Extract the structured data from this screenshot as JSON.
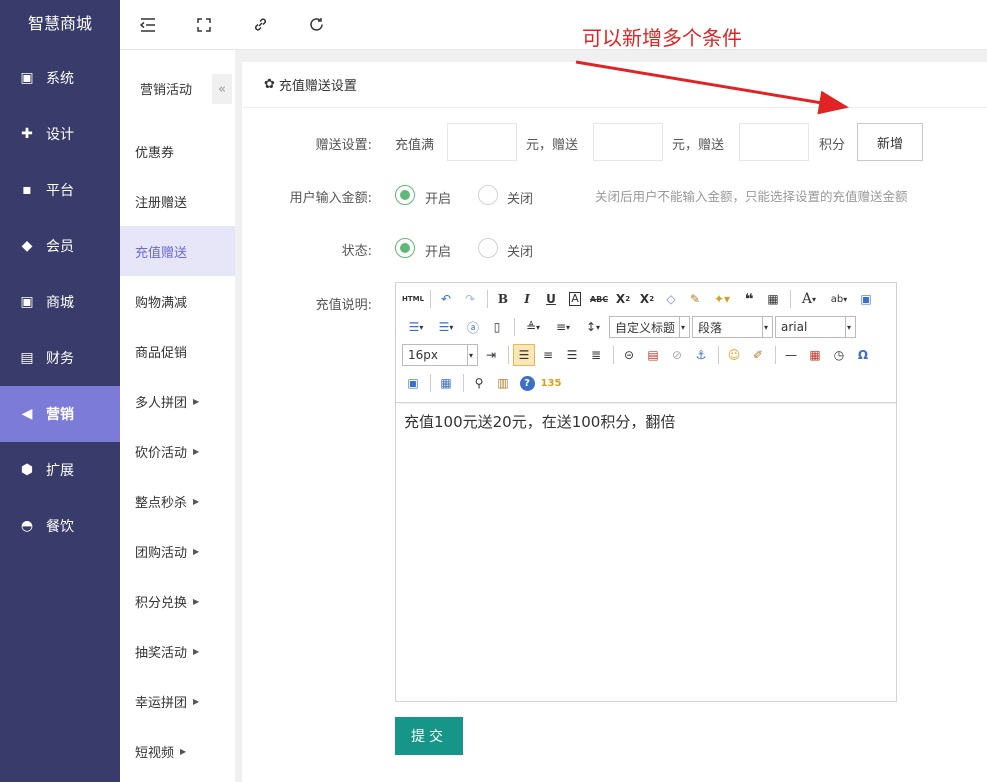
{
  "brand": "智慧商城",
  "sidebar": {
    "items": [
      {
        "label": "系统",
        "icon": "server-icon"
      },
      {
        "label": "设计",
        "icon": "puzzle-icon"
      },
      {
        "label": "平台",
        "icon": "grid-icon"
      },
      {
        "label": "会员",
        "icon": "tag-icon"
      },
      {
        "label": "商城",
        "icon": "shop-icon"
      },
      {
        "label": "财务",
        "icon": "finance-icon"
      },
      {
        "label": "营销",
        "icon": "megaphone-icon",
        "active": true
      },
      {
        "label": "扩展",
        "icon": "cube-icon"
      },
      {
        "label": "餐饮",
        "icon": "dish-icon"
      }
    ]
  },
  "topbar": {
    "icons": [
      "menu-fold-icon",
      "fullscreen-icon",
      "link-icon",
      "refresh-icon"
    ]
  },
  "submenu": {
    "title": "营销活动",
    "collapse": "«",
    "items": [
      {
        "label": "优惠券"
      },
      {
        "label": "注册赠送"
      },
      {
        "label": "充值赠送",
        "active": true
      },
      {
        "label": "购物满减"
      },
      {
        "label": "商品促销"
      },
      {
        "label": "多人拼团",
        "arrow": "▶"
      },
      {
        "label": "砍价活动",
        "arrow": "▶"
      },
      {
        "label": "整点秒杀",
        "arrow": "▶"
      },
      {
        "label": "团购活动",
        "arrow": "▶"
      },
      {
        "label": "积分兑换",
        "arrow": "▶"
      },
      {
        "label": "抽奖活动",
        "arrow": "▶"
      },
      {
        "label": "幸运拼团",
        "arrow": "▶"
      },
      {
        "label": "短视频",
        "arrow": "▶"
      }
    ]
  },
  "panel": {
    "title": "充值赠送设置",
    "gift": {
      "label": "赠送设置:",
      "t1": "充值满",
      "t2": "元，赠送",
      "t3": "元，赠送",
      "t4": "积分",
      "v1": "",
      "v2": "",
      "v3": "",
      "add": "新增"
    },
    "user_input": {
      "label": "用户输入金额:",
      "on": "开启",
      "off": "关闭",
      "hint": "关闭后用户不能输入金额，只能选择设置的充值赠送金额"
    },
    "status": {
      "label": "状态:",
      "on": "开启",
      "off": "关闭"
    },
    "desc": {
      "label": "充值说明:",
      "content": "充值100元送20元，在送100积分，翻倍",
      "combo_heading": "自定义标题",
      "combo_para": "段落",
      "combo_font": "arial",
      "combo_size": "16px",
      "html_btn": "HTML"
    },
    "submit": "提交"
  },
  "annotation": {
    "text": "可以新增多个条件",
    "color": "#e02424"
  }
}
